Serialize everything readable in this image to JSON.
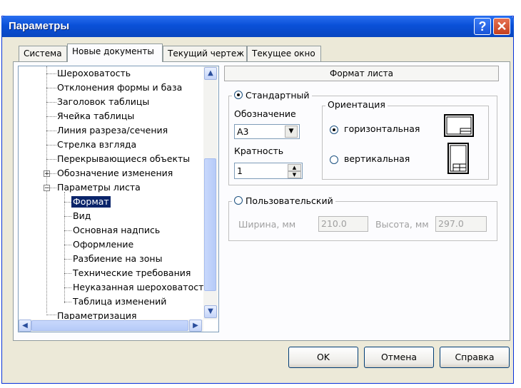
{
  "window": {
    "title": "Параметры",
    "help_glyph": "?",
    "close_glyph": "✕"
  },
  "tabs": [
    {
      "label": "Система"
    },
    {
      "label": "Новые документы"
    },
    {
      "label": "Текущий чертеж"
    },
    {
      "label": "Текущее окно"
    }
  ],
  "tree": {
    "items": [
      "Шероховатость",
      "Отклонения формы и база",
      "Заголовок таблицы",
      "Ячейка таблицы",
      "Линия разреза/сечения",
      "Стрелка взгляда",
      "Перекрывающиеся объекты",
      "Обозначение изменения",
      "Параметры листа",
      "Формат",
      "Вид",
      "Основная надпись",
      "Оформление",
      "Разбиение на зоны",
      "Технические требования",
      "Неуказанная шероховатость",
      "Таблица изменений",
      "Параметризация"
    ],
    "selected": "Формат",
    "expand_plus": "+",
    "expand_minus": "−"
  },
  "scroll": {
    "up": "▲",
    "down": "▼",
    "left": "◀",
    "right": "▶"
  },
  "panel": {
    "header": "Формат листа",
    "standard": {
      "label": "Стандартный",
      "checked": true,
      "designation_label": "Обозначение",
      "designation_value": "A3",
      "multiplicity_label": "Кратность",
      "multiplicity_value": "1"
    },
    "orientation": {
      "label": "Ориентация",
      "horizontal": "горизонтальная",
      "vertical": "вертикальная",
      "selected": "горизонтальная"
    },
    "custom": {
      "label": "Пользовательский",
      "checked": false,
      "width_label": "Ширина, мм",
      "width_value": "210.0",
      "height_label": "Высота, мм",
      "height_value": "297.0"
    }
  },
  "buttons": {
    "ok": "OK",
    "cancel": "Отмена",
    "help": "Справка"
  },
  "colors": {
    "titlebar": "#0a50d8",
    "selection": "#0a246a",
    "dialog_bg": "#ece9d8",
    "panel_bg": "#fcfcfe"
  }
}
